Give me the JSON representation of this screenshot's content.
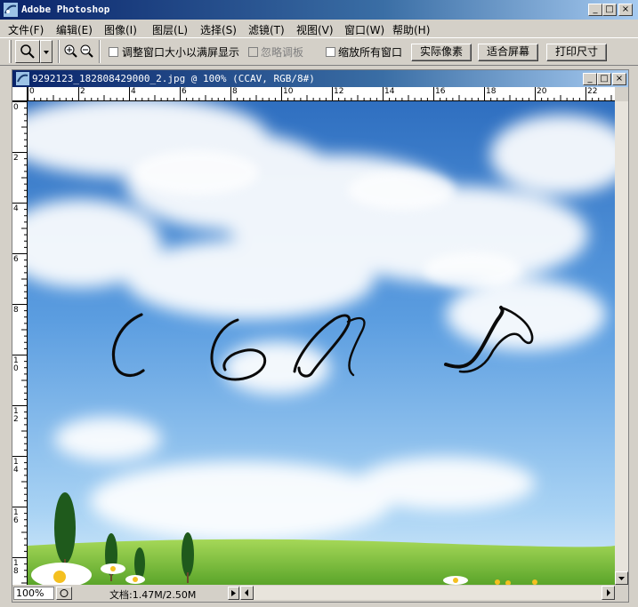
{
  "app": {
    "title": "Adobe Photoshop"
  },
  "menu": [
    "文件(F)",
    "编辑(E)",
    "图像(I)",
    "图层(L)",
    "选择(S)",
    "滤镜(T)",
    "视图(V)",
    "窗口(W)",
    "帮助(H)"
  ],
  "options": {
    "resize_windows_label": "调整窗口大小以满屏显示",
    "ignore_palettes_label": "忽略调板",
    "zoom_all_label": "缩放所有窗口",
    "actual_pixels": "实际像素",
    "fit_screen": "适合屏幕",
    "print_size": "打印尺寸"
  },
  "document": {
    "title": "9292123_182808429000_2.jpg @ 100% (CCAV, RGB/8#)",
    "artwork_text": "CCAV"
  },
  "rulers": {
    "horizontal": [
      "0",
      "2",
      "4",
      "6",
      "8",
      "10",
      "12",
      "14",
      "16",
      "18",
      "20",
      "22"
    ],
    "vertical": [
      "0",
      "2",
      "4",
      "6",
      "8",
      "10",
      "12",
      "14",
      "16",
      "18"
    ]
  },
  "status": {
    "zoom": "100%",
    "doc_info": "文档:1.47M/2.50M"
  },
  "icons": [
    "photoshop-icon",
    "zoom-tool-icon",
    "zoom-in-icon",
    "zoom-out-icon",
    "minimize-icon",
    "maximize-icon",
    "close-icon"
  ],
  "colors": {
    "titlebar": "#0a246a",
    "sky": "#4a90d9",
    "grass": "#7cc23a"
  }
}
